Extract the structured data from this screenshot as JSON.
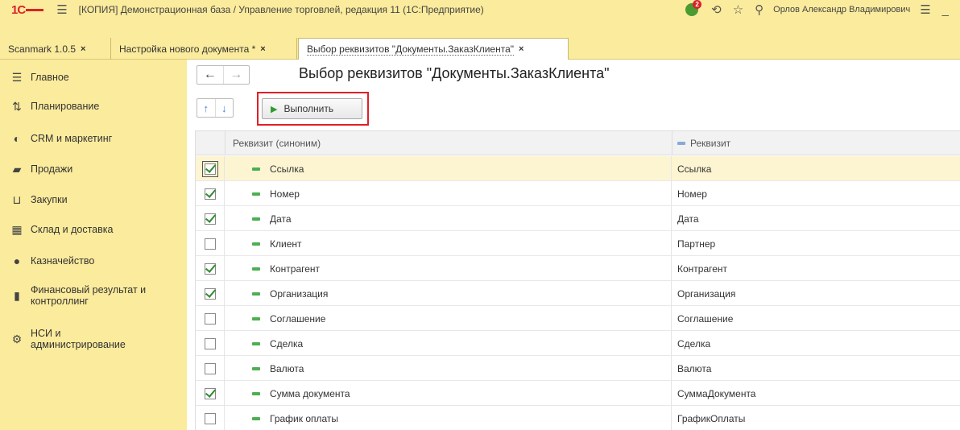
{
  "titlebar": {
    "logo": "1С",
    "title": "[КОПИЯ] Демонстрационная база / Управление торговлей, редакция 11  (1С:Предприятие)",
    "notification_count": "2",
    "user": "Орлов Александр Владимирович",
    "icons": [
      "history-icon",
      "star-icon",
      "search-icon",
      "menu-icon",
      "minimize-icon"
    ]
  },
  "tabs": [
    {
      "label": "Scanmark 1.0.5",
      "close": "×",
      "active": false
    },
    {
      "label": "Настройка нового документа *",
      "close": "×",
      "active": false
    },
    {
      "label": "Выбор реквизитов \"Документы.ЗаказКлиента\"",
      "close": "×",
      "active": true
    }
  ],
  "sidebar": {
    "items": [
      {
        "label": "Главное",
        "icon": "menu-icon"
      },
      {
        "label": "Планирование",
        "icon": "planning-icon"
      },
      {
        "label": "CRM и маркетинг",
        "icon": "crm-icon"
      },
      {
        "label": "Продажи",
        "icon": "bag-icon"
      },
      {
        "label": "Закупки",
        "icon": "cart-icon"
      },
      {
        "label": "Склад и доставка",
        "icon": "warehouse-icon"
      },
      {
        "label": "Казначейство",
        "icon": "coin-icon"
      },
      {
        "label": "Финансовый результат и контроллинг",
        "icon": "chart-icon"
      },
      {
        "label": "НСИ и администрирование",
        "icon": "gear-icon"
      }
    ]
  },
  "form": {
    "title": "Выбор реквизитов \"Документы.ЗаказКлиента\"",
    "run_label": "Выполнить"
  },
  "table": {
    "columns": [
      "Реквизит (синоним)",
      "Реквизит"
    ],
    "rows": [
      {
        "checked": true,
        "synonym": "Ссылка",
        "attr": "Ссылка",
        "selected": true
      },
      {
        "checked": true,
        "synonym": "Номер",
        "attr": "Номер",
        "selected": false
      },
      {
        "checked": true,
        "synonym": "Дата",
        "attr": "Дата",
        "selected": false
      },
      {
        "checked": false,
        "synonym": "Клиент",
        "attr": "Партнер",
        "selected": false
      },
      {
        "checked": true,
        "synonym": "Контрагент",
        "attr": "Контрагент",
        "selected": false
      },
      {
        "checked": true,
        "synonym": "Организация",
        "attr": "Организация",
        "selected": false
      },
      {
        "checked": false,
        "synonym": "Соглашение",
        "attr": "Соглашение",
        "selected": false
      },
      {
        "checked": false,
        "synonym": "Сделка",
        "attr": "Сделка",
        "selected": false
      },
      {
        "checked": false,
        "synonym": "Валюта",
        "attr": "Валюта",
        "selected": false
      },
      {
        "checked": true,
        "synonym": "Сумма документа",
        "attr": "СуммаДокумента",
        "selected": false
      },
      {
        "checked": false,
        "synonym": "График оплаты",
        "attr": "ГрафикОплаты",
        "selected": false
      }
    ]
  },
  "colors": {
    "panel": "#fbeb9c",
    "highlight_border": "#e01f26",
    "selected_row": "#fdf5d2",
    "check": "#2e8b2e"
  }
}
